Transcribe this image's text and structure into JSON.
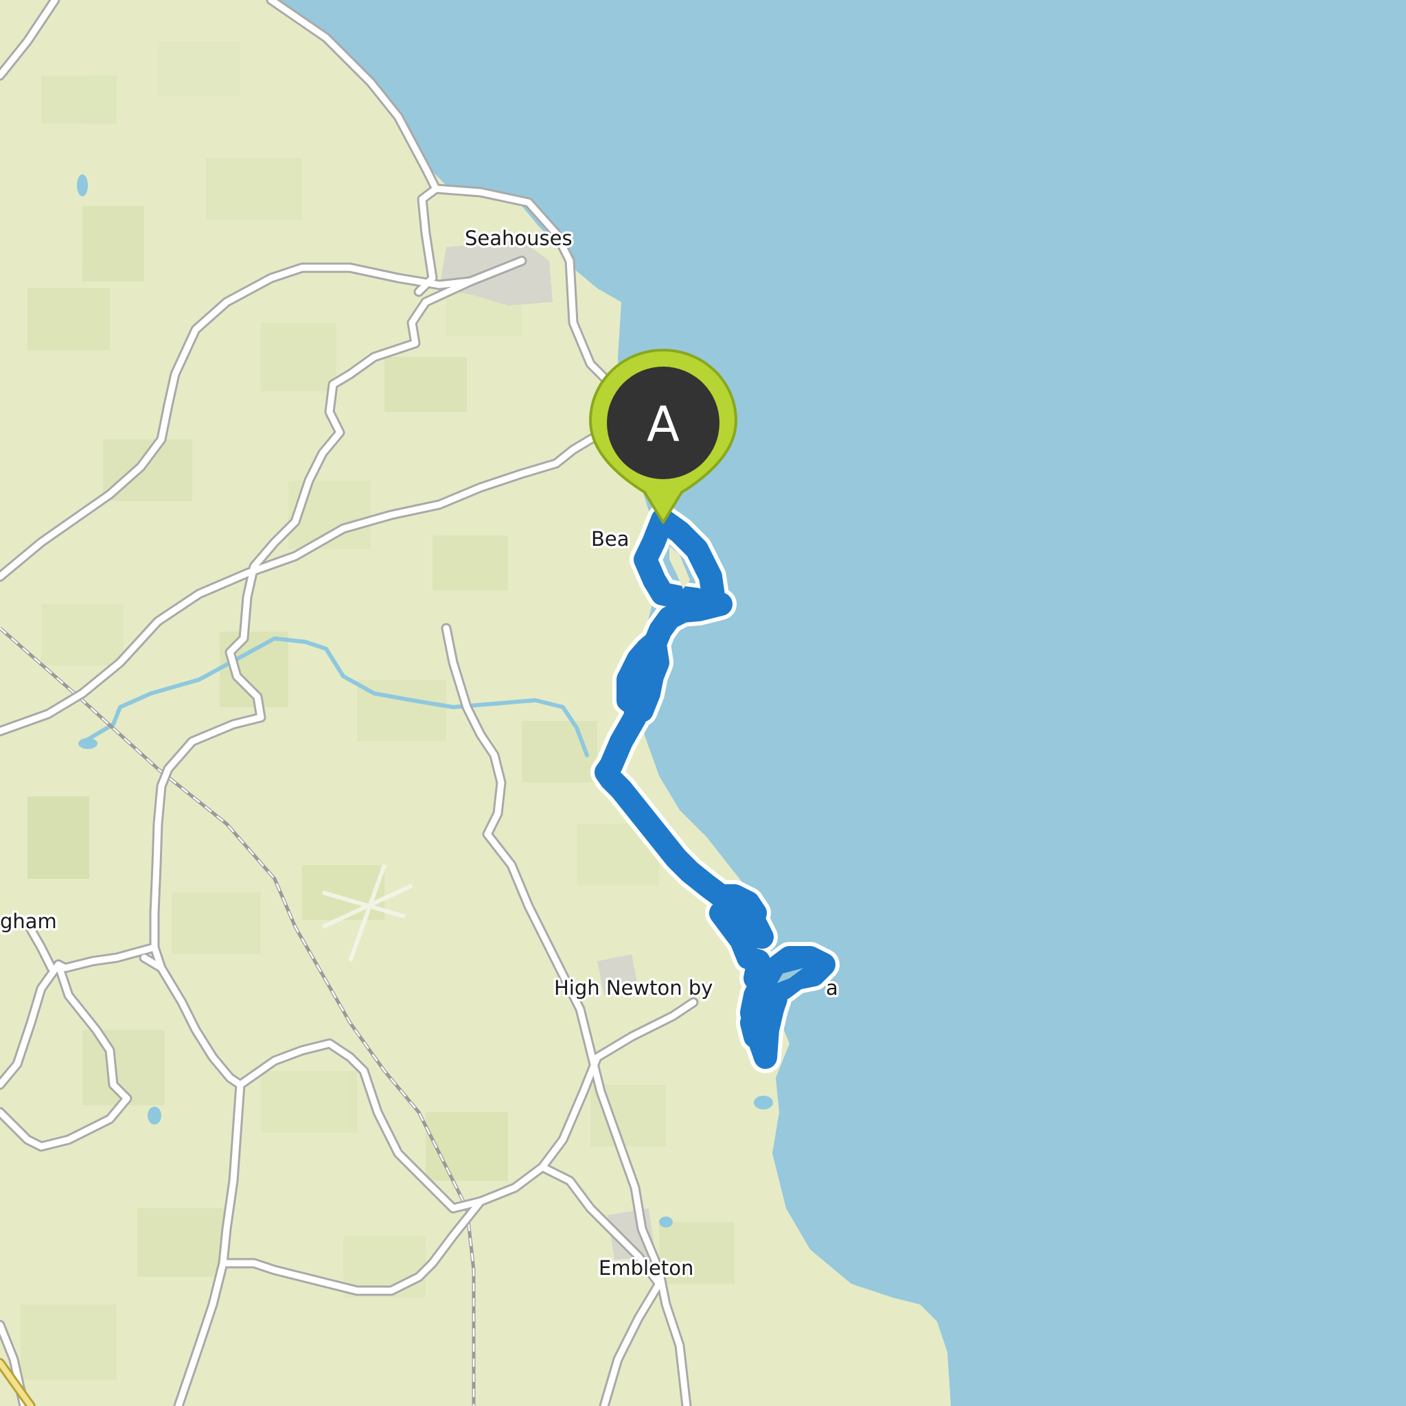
{
  "map": {
    "place_labels": {
      "seahouses": "Seahouses",
      "beadnell": "Bea",
      "high_newton": "High Newton by",
      "high_newton_tail": "a",
      "bamburgh_partial": "gham",
      "embleton": "Embleton"
    },
    "start_marker": {
      "letter": "A",
      "colors": {
        "pin_fill": "#b6d432",
        "pin_stroke": "#8aa81c",
        "inner_circle": "#333333",
        "letter": "#ffffff"
      }
    },
    "colors": {
      "sea": "#97c8dc",
      "land": "#e6ebc6",
      "road": "#ffffff",
      "road_casing": "#a0a0a0",
      "river": "#8ec8de",
      "route": "#1f7acb",
      "route_casing": "#ffffff",
      "railway": "#8a8a8a"
    }
  }
}
